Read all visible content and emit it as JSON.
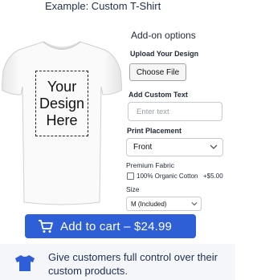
{
  "page": {
    "title": "Example: Custom T-Shirt"
  },
  "product": {
    "design_placeholder": "Your Design Here"
  },
  "addons": {
    "title": "Add-on options",
    "upload_label": "Upload Your Design",
    "upload_button": "Choose File",
    "custom_text_label": "Add Custom Text",
    "custom_text_placeholder": "Enter text",
    "placement_label": "Print Placement",
    "placement_value": "Front",
    "premium_label": "Premium Fabric",
    "premium_option": "100% Organic Cotton",
    "premium_price": "+$5.00",
    "premium_checked": false,
    "size_label": "Size",
    "size_value": "M (Included)"
  },
  "cart": {
    "label": "Add to cart  –  $24.99",
    "icon": "cart-icon",
    "color": "#2f5fd6"
  },
  "footer": {
    "icon": "tshirt-icon",
    "text": "Give customers full control over their custom products."
  }
}
